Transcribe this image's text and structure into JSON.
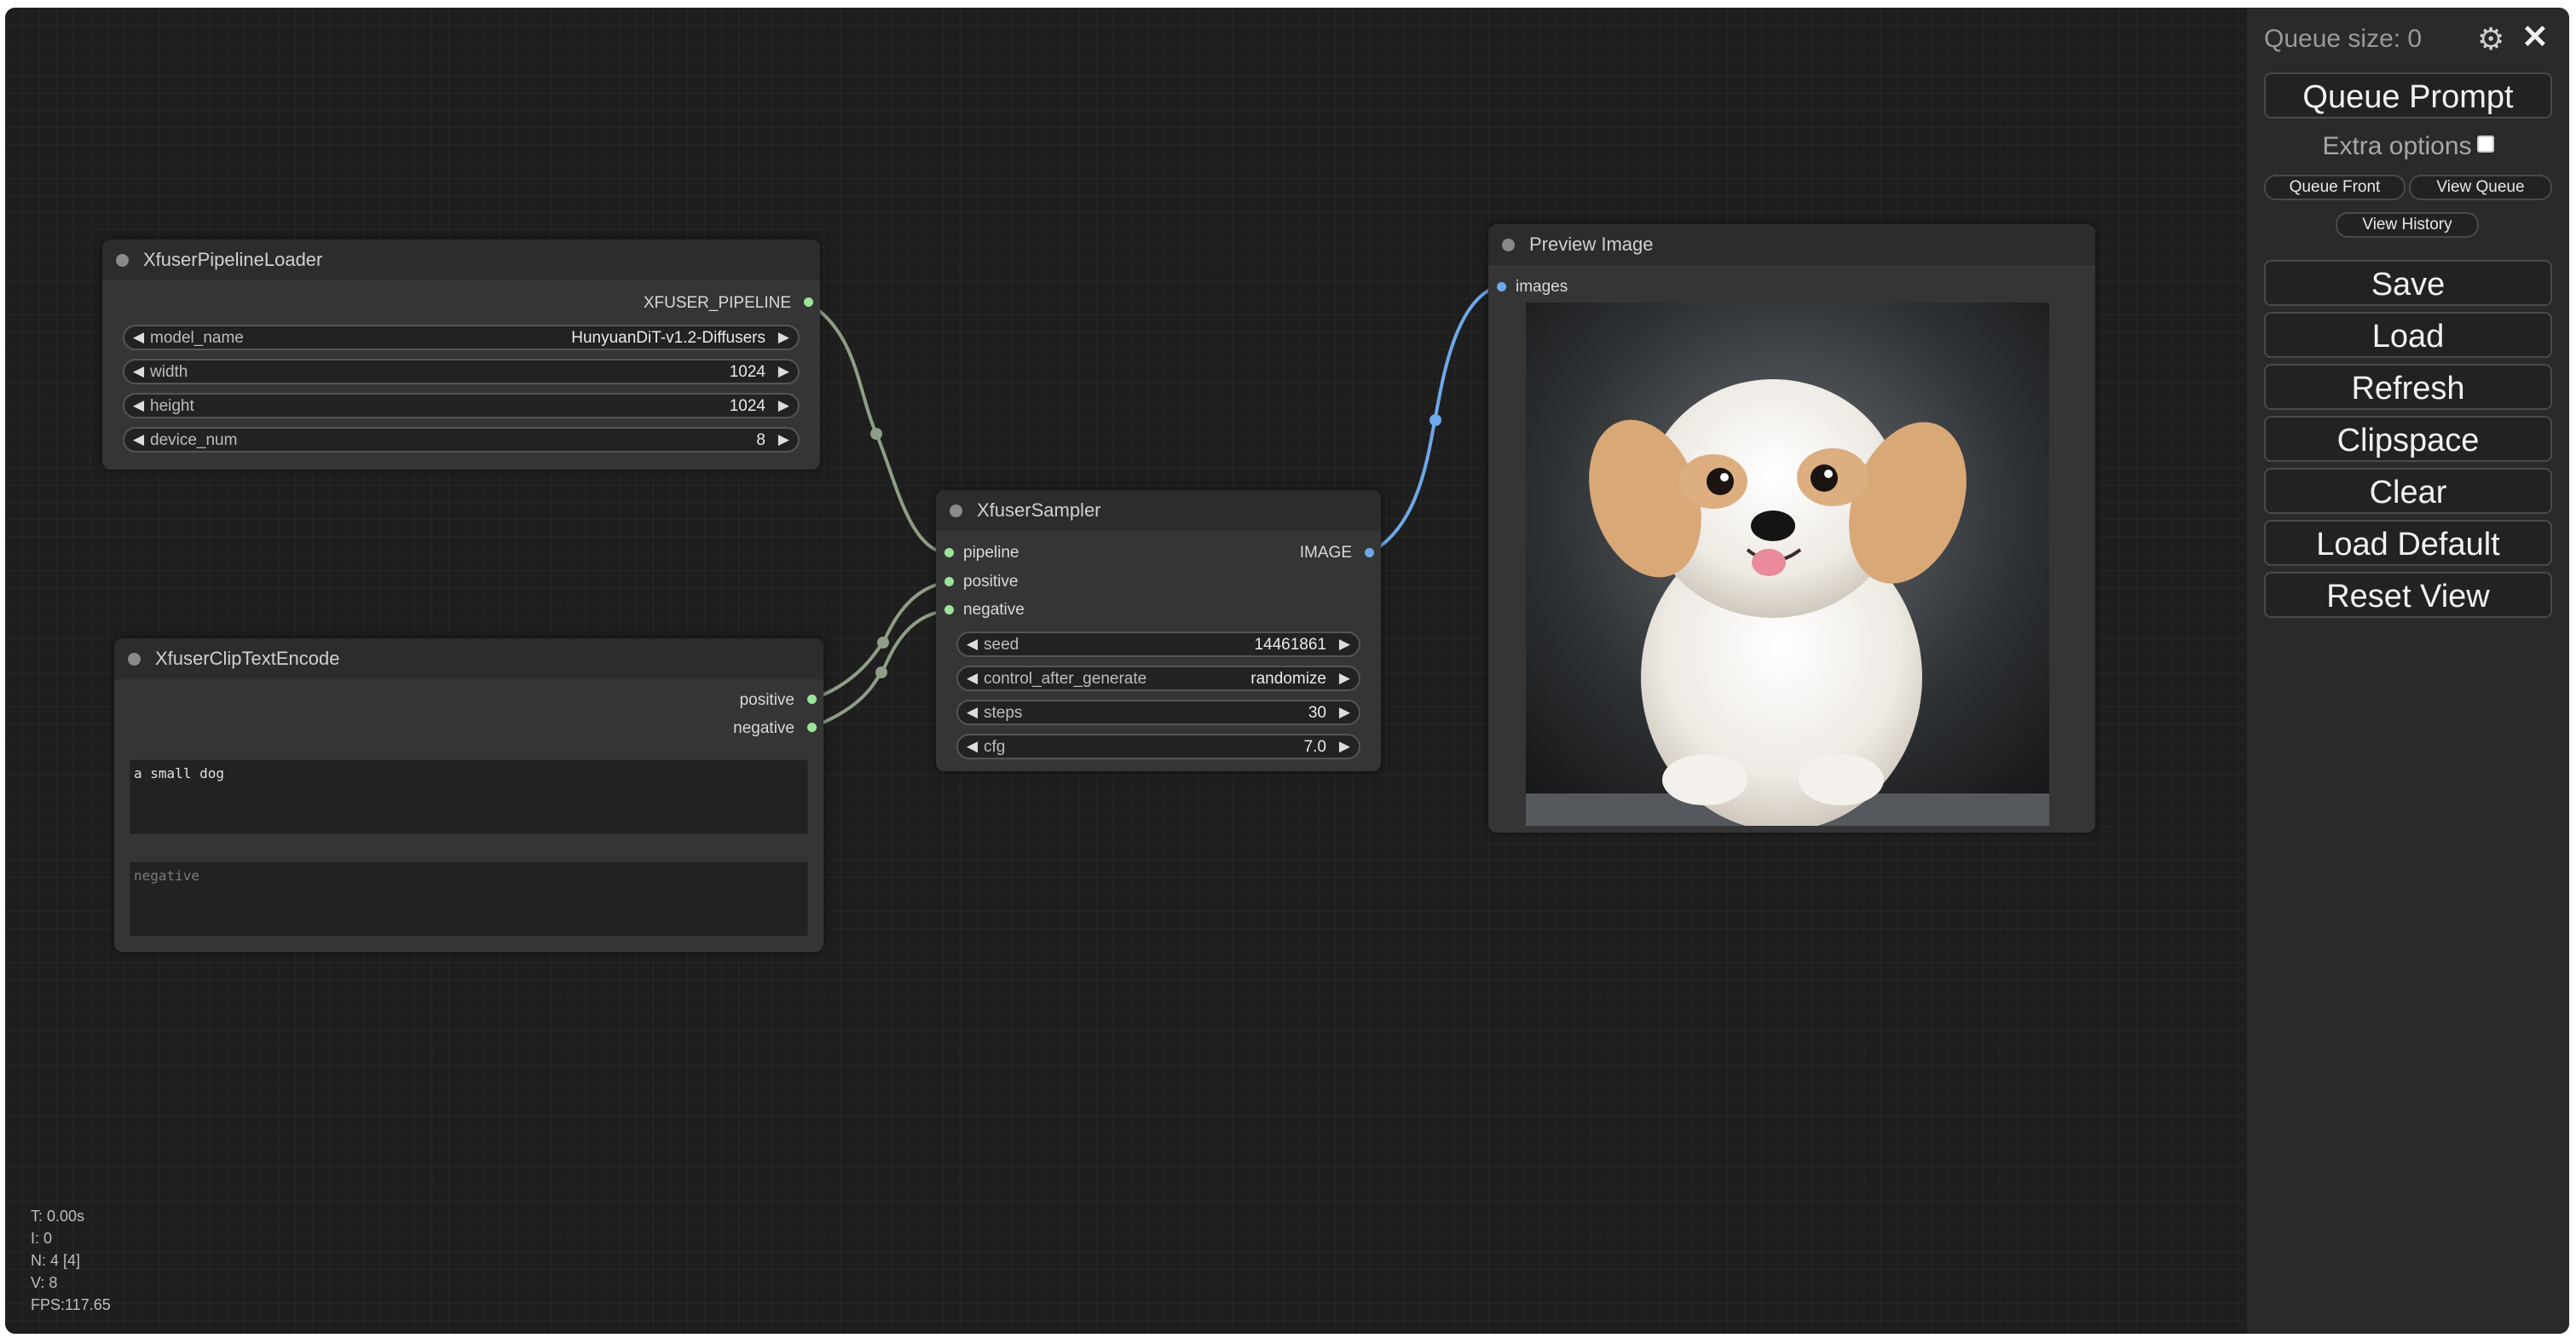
{
  "nodes": {
    "pipeline_loader": {
      "title": "XfuserPipelineLoader",
      "output": "XFUSER_PIPELINE",
      "widgets": [
        {
          "label": "model_name",
          "value": "HunyuanDiT-v1.2-Diffusers"
        },
        {
          "label": "width",
          "value": "1024"
        },
        {
          "label": "height",
          "value": "1024"
        },
        {
          "label": "device_num",
          "value": "8"
        }
      ]
    },
    "clip_text_encode": {
      "title": "XfuserClipTextEncode",
      "outputs": [
        "positive",
        "negative"
      ],
      "positive_text": "a small dog",
      "negative_placeholder": "negative"
    },
    "sampler": {
      "title": "XfuserSampler",
      "inputs": [
        "pipeline",
        "positive",
        "negative"
      ],
      "output": "IMAGE",
      "widgets": [
        {
          "label": "seed",
          "value": "14461861"
        },
        {
          "label": "control_after_generate",
          "value": "randomize"
        },
        {
          "label": "steps",
          "value": "30"
        },
        {
          "label": "cfg",
          "value": "7.0"
        }
      ]
    },
    "preview": {
      "title": "Preview Image",
      "input": "images"
    }
  },
  "stats": {
    "t": "T: 0.00s",
    "i": "I: 0",
    "n": "N: 4 [4]",
    "v": "V: 8",
    "fps": "FPS:117.65"
  },
  "menu": {
    "queue_size": "Queue size: 0",
    "settings_icon": "gear-icon",
    "close_icon": "close-icon",
    "queue_prompt": "Queue Prompt",
    "extra_options": "Extra options",
    "queue_front": "Queue Front",
    "view_queue": "View Queue",
    "view_history": "View History",
    "save": "Save",
    "load": "Load",
    "refresh": "Refresh",
    "clipspace": "Clipspace",
    "clear": "Clear",
    "load_default": "Load Default",
    "reset_view": "Reset View"
  },
  "colors": {
    "canvas_bg": "#1e1e1e",
    "node_bg": "#353535",
    "node_title_bg": "#2c2c2c",
    "link_green": "#8f9e86",
    "link_blue": "#6fa8e8",
    "slot_green": "#9be29b",
    "menu_bg": "#2a2a2a"
  }
}
